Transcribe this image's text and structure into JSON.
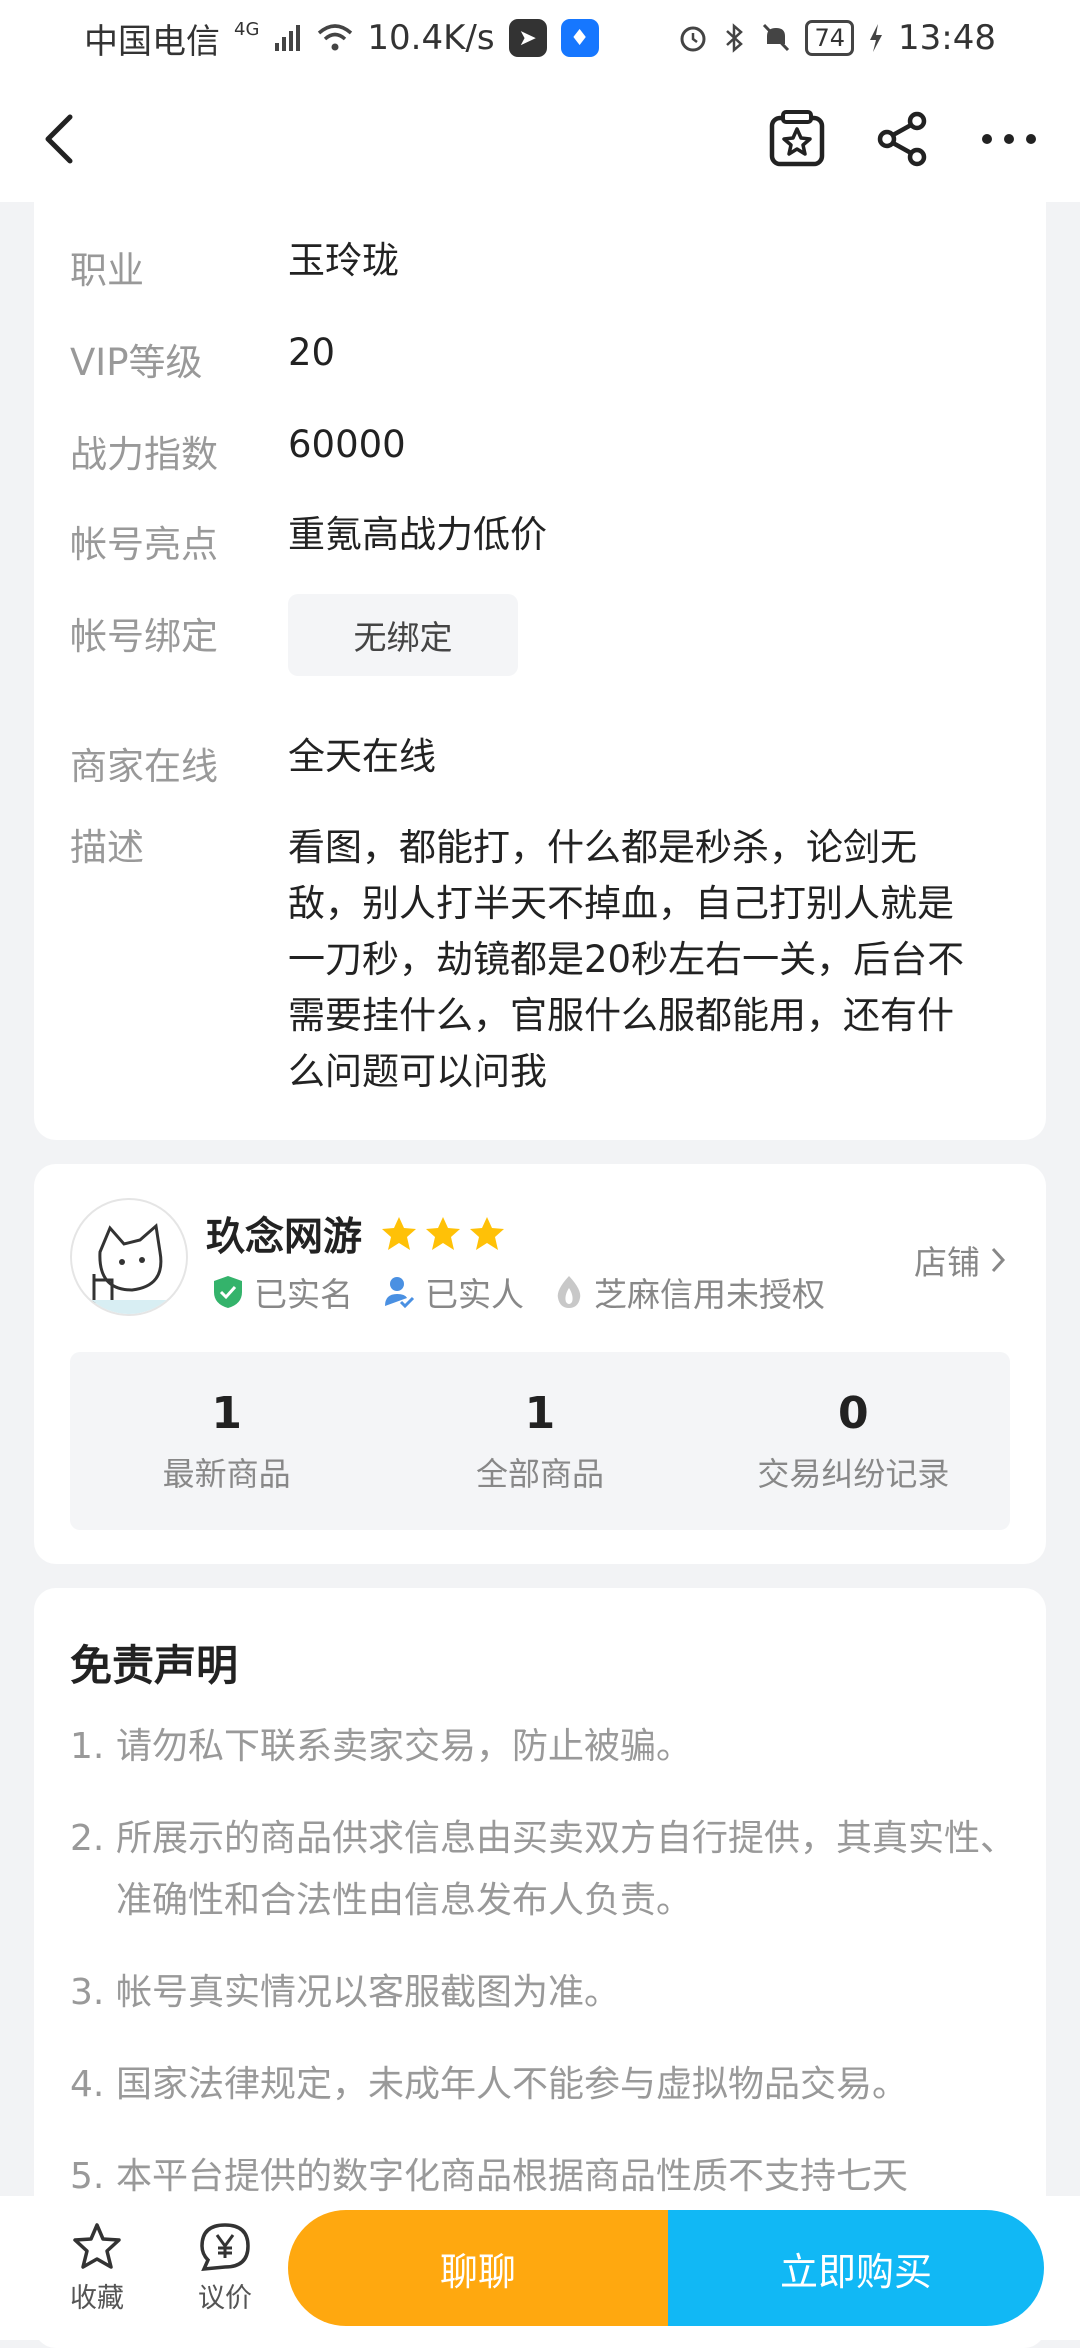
{
  "status_bar": {
    "carrier": "中国电信",
    "network": "4G",
    "speed": "10.4K/s",
    "battery": "74",
    "time": "13:48",
    "icons": [
      "signal-icon",
      "wifi-icon",
      "app-notification-icon",
      "bulb-notification-icon",
      "alarm-icon",
      "bluetooth-icon",
      "mute-icon",
      "battery-icon",
      "charging-icon"
    ]
  },
  "nav": {
    "icons": [
      "back-icon",
      "favorite-star-icon",
      "share-icon",
      "more-icon"
    ]
  },
  "info": {
    "rows": [
      {
        "label": "职业",
        "value": "玉玲珑"
      },
      {
        "label": "VIP等级",
        "value": "20"
      },
      {
        "label": "战力指数",
        "value": "60000"
      },
      {
        "label": "帐号亮点",
        "value": "重氪高战力低价"
      },
      {
        "label": "帐号绑定",
        "value": "无绑定"
      },
      {
        "label": "商家在线",
        "value": "全天在线"
      },
      {
        "label": "描述",
        "value": "看图，都能打，什么都是秒杀，论剑无敌，别人打半天不掉血，自己打别人就是一刀秒，劫镜都是20秒左右一关，后台不需要挂什么，官服什么服都能用，还有什么问题可以问我"
      }
    ]
  },
  "shop": {
    "name": "玖念网游",
    "stars": 3,
    "badges": [
      "已实名",
      "已实人",
      "芝麻信用未授权"
    ],
    "link_label": "店铺",
    "stats": [
      {
        "value": "1",
        "label": "最新商品"
      },
      {
        "value": "1",
        "label": "全部商品"
      },
      {
        "value": "0",
        "label": "交易纠纷记录"
      }
    ]
  },
  "disclaimer": {
    "title": "免责声明",
    "items": [
      {
        "no": "1.",
        "text": "请勿私下联系卖家交易，防止被骗。"
      },
      {
        "no": "2.",
        "text": "所展示的商品供求信息由买卖双方自行提供，其真实性、准确性和合法性由信息发布人负责。"
      },
      {
        "no": "3.",
        "text": "帐号真实情况以客服截图为准。"
      },
      {
        "no": "4.",
        "text": "国家法律规定，未成年人不能参与虚拟物品交易。"
      },
      {
        "no": "5.",
        "text": "本平台提供的数字化商品根据商品性质不支持七天"
      }
    ]
  },
  "bottom": {
    "favorite_label": "收藏",
    "bargain_label": "议价",
    "chat_label": "聊聊",
    "buy_label": "立即购买"
  },
  "colors": {
    "chat": "#ffa80f",
    "buy": "#11b8f5",
    "star": "#ffc107",
    "verified": "#34b36b"
  }
}
